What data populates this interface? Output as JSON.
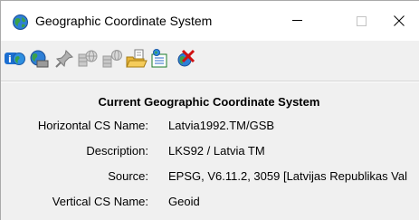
{
  "window": {
    "title": "Geographic Coordinate System",
    "app_icon": "globe-icon",
    "controls": {
      "minimize": "minimize-icon",
      "maximize": "maximize-icon",
      "close": "close-icon"
    }
  },
  "toolbar": {
    "buttons": [
      {
        "name": "info-icon"
      },
      {
        "name": "globe-select-icon"
      },
      {
        "name": "pin-icon"
      },
      {
        "name": "globe-grid-icon"
      },
      {
        "name": "globe-grid-alt-icon"
      },
      {
        "name": "folder-open-icon"
      },
      {
        "name": "list-icon"
      },
      {
        "name": "remove-icon"
      }
    ]
  },
  "content": {
    "heading": "Current Geographic Coordinate System",
    "rows": [
      {
        "label": "Horizontal CS Name:",
        "value": "Latvia1992.TM/GSB"
      },
      {
        "label": "Description:",
        "value": "LKS92 / Latvia TM"
      },
      {
        "label": "Source:",
        "value": "EPSG, V6.11.2, 3059 [Latvijas Republikas Val"
      },
      {
        "label": "Vertical CS Name:",
        "value": "Geoid"
      }
    ]
  },
  "colors": {
    "toolbar_bg": "#f0f0f0",
    "content_bg": "#f0f0f0",
    "titlebar_bg": "#ffffff"
  }
}
